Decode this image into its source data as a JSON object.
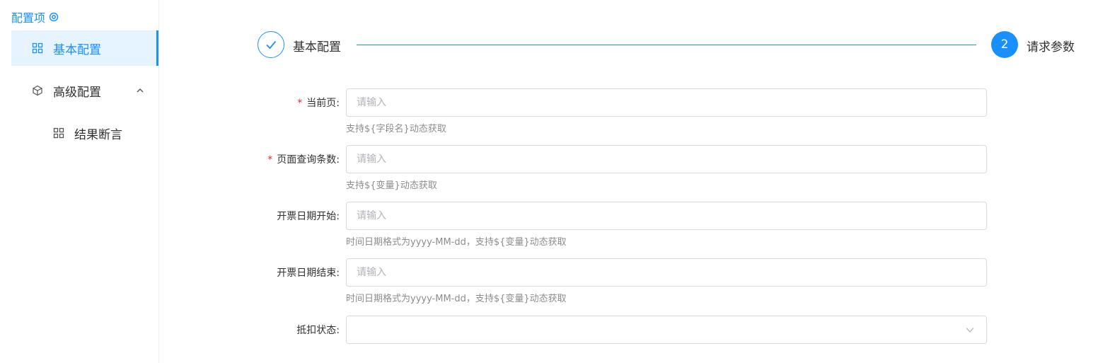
{
  "sidebar": {
    "title": "配置项",
    "items": [
      {
        "label": "基本配置",
        "icon": "grid-icon",
        "active": true
      },
      {
        "label": "高级配置",
        "icon": "cube-icon",
        "expanded": true
      },
      {
        "label": "结果断言",
        "icon": "grid-icon",
        "sub": true
      }
    ]
  },
  "steps": [
    {
      "label": "基本配置",
      "status": "finished"
    },
    {
      "number": "2",
      "label": "请求参数",
      "status": "current"
    }
  ],
  "form": {
    "fields": [
      {
        "label": "当前页:",
        "required": true,
        "placeholder": "请输入",
        "hint": "支持${字段名}动态获取"
      },
      {
        "label": "页面查询条数:",
        "required": true,
        "placeholder": "请输入",
        "hint": "支持${变量}动态获取"
      },
      {
        "label": "开票日期开始:",
        "required": false,
        "placeholder": "请输入",
        "hint": "时间日期格式为yyyy-MM-dd，支持${变量}动态获取"
      },
      {
        "label": "开票日期结束:",
        "required": false,
        "placeholder": "请输入",
        "hint": "时间日期格式为yyyy-MM-dd，支持${变量}动态获取"
      },
      {
        "label": "抵扣状态:",
        "required": false,
        "type": "select",
        "value": ""
      }
    ],
    "required_mark": "*"
  },
  "colors": {
    "accent": "#1890ff",
    "required": "#f5222d",
    "active_bg": "#e6f4ff"
  }
}
